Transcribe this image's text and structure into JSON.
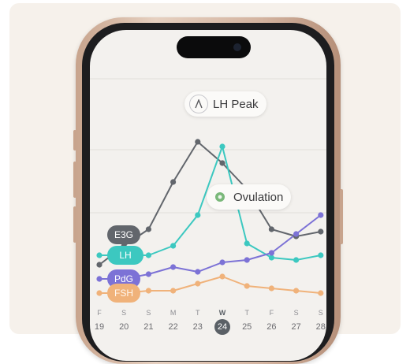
{
  "callouts": {
    "lh_peak": "LH Peak",
    "ovulation": "Ovulation"
  },
  "legend": [
    {
      "label": "E3G",
      "color": "#62666c"
    },
    {
      "label": "LH",
      "color": "#3cc8c0"
    },
    {
      "label": "PdG",
      "color": "#7c72d6"
    },
    {
      "label": "FSH",
      "color": "#f0b27a"
    }
  ],
  "days": [
    {
      "letter": "F",
      "num": "19"
    },
    {
      "letter": "S",
      "num": "20"
    },
    {
      "letter": "S",
      "num": "21"
    },
    {
      "letter": "M",
      "num": "22"
    },
    {
      "letter": "T",
      "num": "23"
    },
    {
      "letter": "W",
      "num": "24",
      "active": true
    },
    {
      "letter": "T",
      "num": "25"
    },
    {
      "letter": "F",
      "num": "26"
    },
    {
      "letter": "S",
      "num": "27"
    },
    {
      "letter": "S",
      "num": "28"
    }
  ],
  "chart_data": {
    "type": "line",
    "x": [
      "19",
      "20",
      "21",
      "22",
      "23",
      "24",
      "25",
      "26",
      "27",
      "28"
    ],
    "ylim": [
      0,
      100
    ],
    "series": [
      {
        "name": "E3G",
        "color": "#62666c",
        "values": [
          40,
          48,
          55,
          75,
          92,
          83,
          72,
          55,
          52,
          54
        ]
      },
      {
        "name": "LH",
        "color": "#3cc8c0",
        "values": [
          44,
          44,
          44,
          48,
          61,
          90,
          49,
          43,
          42,
          44
        ]
      },
      {
        "name": "PdG",
        "color": "#7c72d6",
        "values": [
          34,
          34,
          36,
          39,
          37,
          41,
          42,
          45,
          53,
          61
        ]
      },
      {
        "name": "FSH",
        "color": "#f0b27a",
        "values": [
          28,
          28,
          29,
          29,
          32,
          35,
          31,
          30,
          29,
          28
        ]
      }
    ]
  }
}
